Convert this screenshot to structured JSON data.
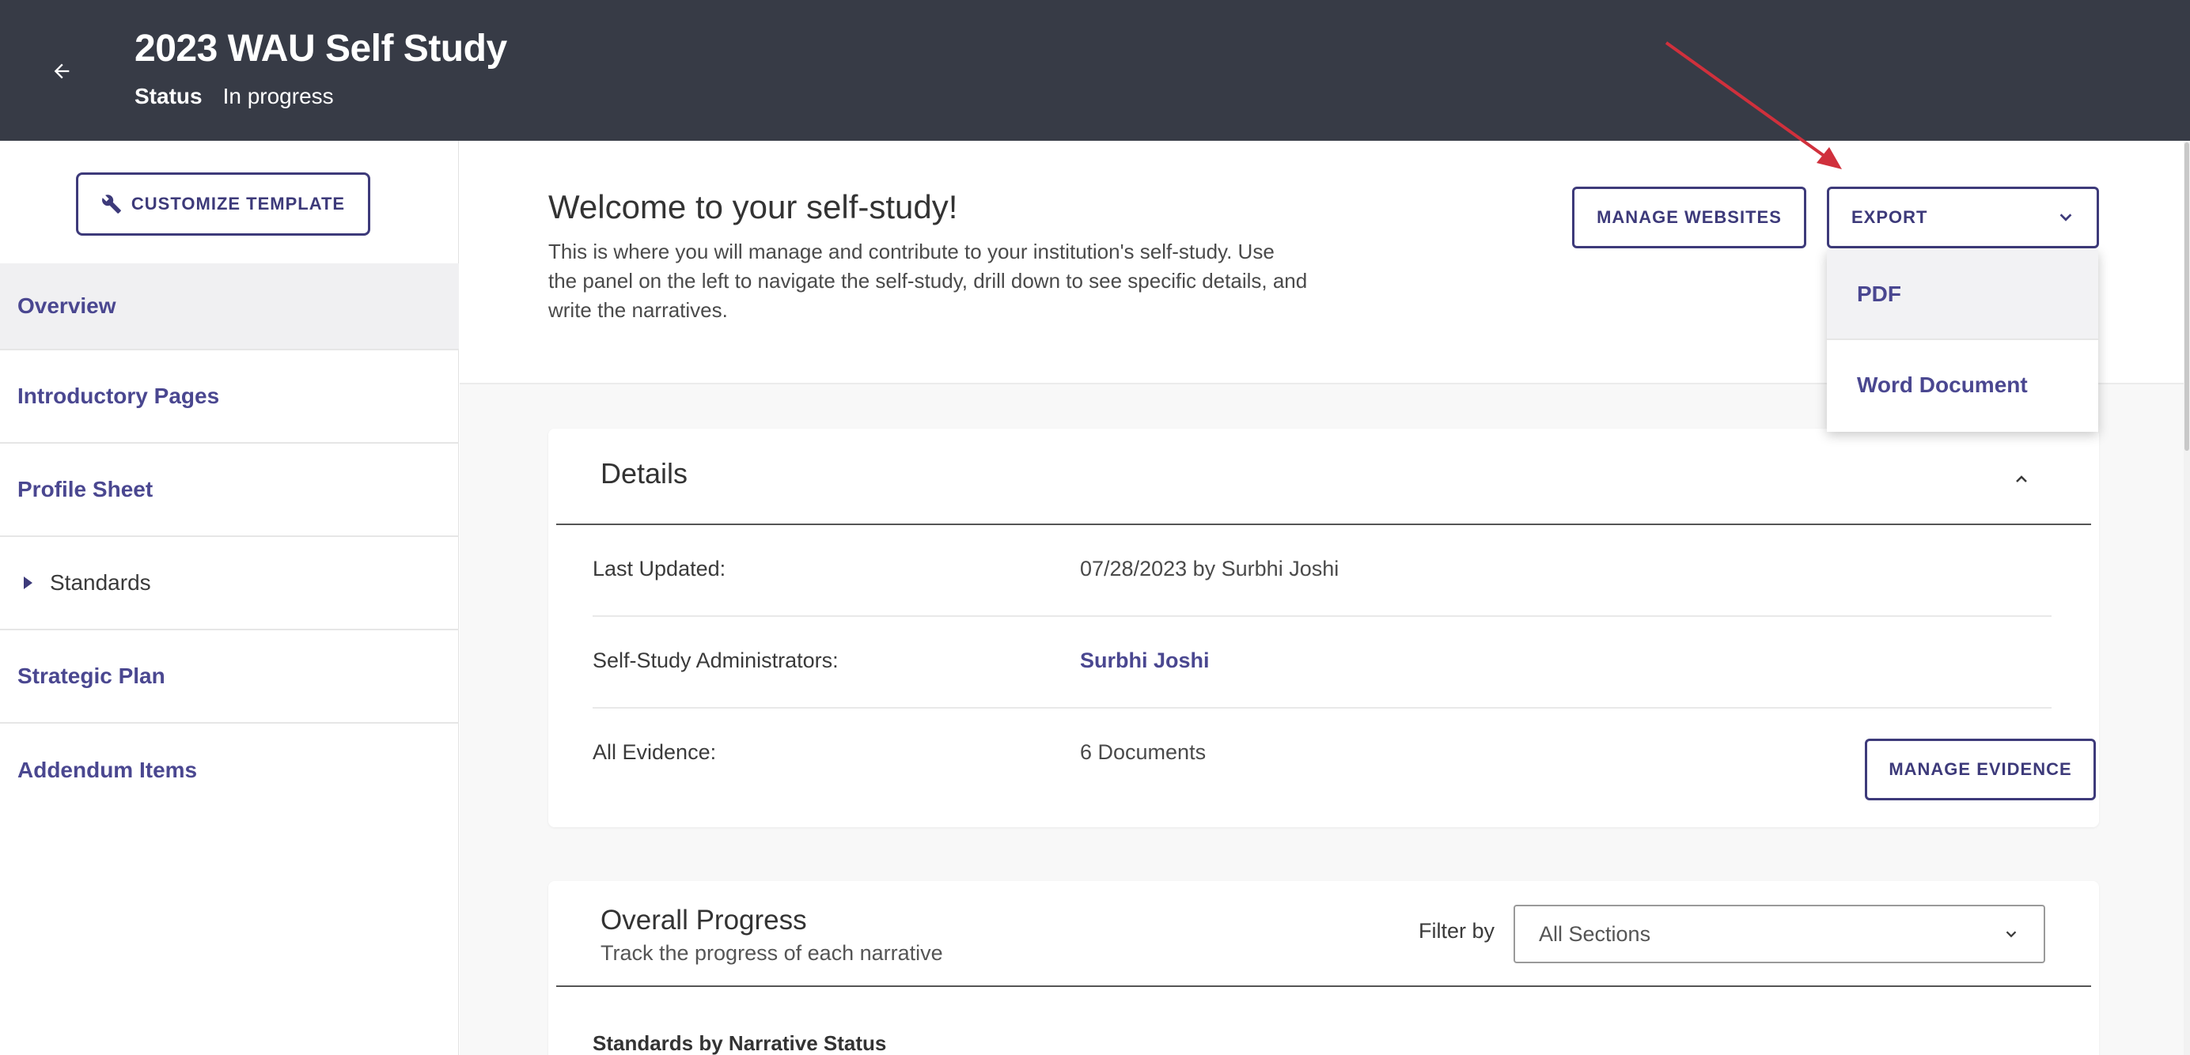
{
  "header": {
    "title": "2023 WAU Self Study",
    "status_label": "Status",
    "status_value": "In progress"
  },
  "sidebar": {
    "customize_label": "CUSTOMIZE TEMPLATE",
    "items": [
      {
        "label": "Overview"
      },
      {
        "label": "Introductory Pages"
      },
      {
        "label": "Profile Sheet"
      },
      {
        "label": "Standards"
      },
      {
        "label": "Strategic Plan"
      },
      {
        "label": "Addendum Items"
      }
    ]
  },
  "welcome": {
    "title": "Welcome to your self-study!",
    "text": "This is where you will manage and contribute to your institution's self-study. Use the panel on the left to navigate the self-study, drill down to see specific details, and write the narratives.",
    "manage_websites_label": "MANAGE WEBSITES",
    "export_label": "EXPORT"
  },
  "export_menu": {
    "options": [
      "PDF",
      "Word Document"
    ]
  },
  "details": {
    "title": "Details",
    "rows": [
      {
        "label": "Last Updated:",
        "value": "07/28/2023 by Surbhi Joshi"
      },
      {
        "label": "Self-Study Administrators:",
        "value": "Surbhi Joshi"
      },
      {
        "label": "All Evidence:",
        "value": "6 Documents"
      }
    ],
    "manage_evidence_label": "MANAGE EVIDENCE"
  },
  "progress": {
    "title": "Overall Progress",
    "subtitle": "Track the progress of each narrative",
    "filter_label": "Filter by",
    "filter_value": "All Sections",
    "standards_status_label": "Standards by Narrative Status"
  },
  "colors": {
    "header_bg": "#373b46",
    "accent": "#3d3a7a",
    "link": "#4a4790",
    "annotation": "#d0303c"
  }
}
